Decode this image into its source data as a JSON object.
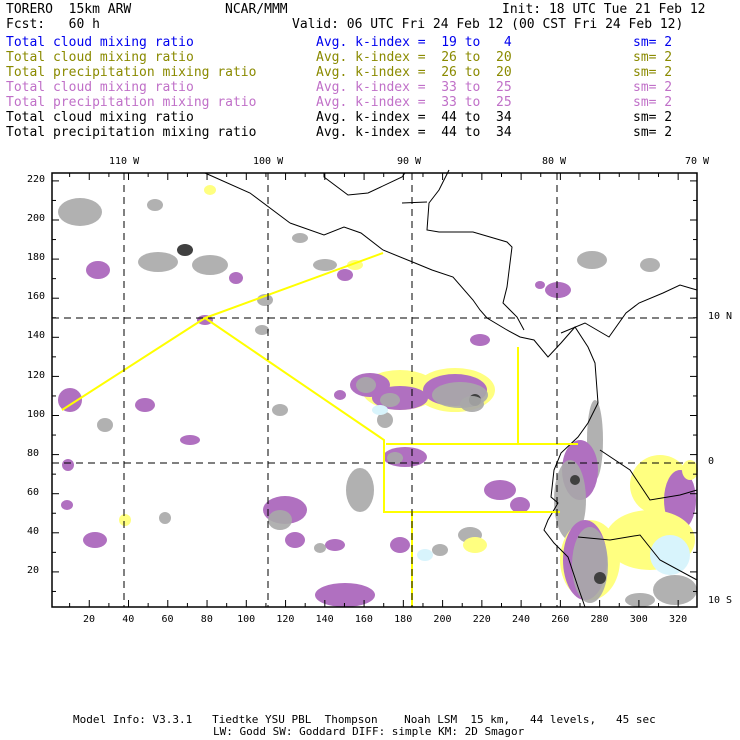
{
  "header": {
    "title": "TORERO  15km ARW",
    "org": "NCAR/MMM",
    "init": "Init: 18 UTC Tue 21 Feb 12",
    "fcst": "Fcst:   60 h",
    "valid": "Valid: 06 UTC Fri 24 Feb 12 (00 CST Fri 24 Feb 12)"
  },
  "legend": [
    {
      "field": "Total cloud mixing ratio",
      "kindex": "Avg. k-index =  19 to   4",
      "sm": "sm= 2",
      "color": "#0000ee"
    },
    {
      "field": "Total cloud mixing ratio",
      "kindex": "Avg. k-index =  26 to  20",
      "sm": "sm= 2",
      "color": "#8a8a00"
    },
    {
      "field": "Total precipitation mixing ratio",
      "kindex": "Avg. k-index =  26 to  20",
      "sm": "sm= 2",
      "color": "#8a8a00"
    },
    {
      "field": "Total cloud mixing ratio",
      "kindex": "Avg. k-index =  33 to  25",
      "sm": "sm= 2",
      "color": "#c070c8"
    },
    {
      "field": "Total precipitation mixing ratio",
      "kindex": "Avg. k-index =  33 to  25",
      "sm": "sm= 2",
      "color": "#c070c8"
    },
    {
      "field": "Total cloud mixing ratio",
      "kindex": "Avg. k-index =  44 to  34",
      "sm": "sm= 2",
      "color": "#000000"
    },
    {
      "field": "Total precipitation mixing ratio",
      "kindex": "Avg. k-index =  44 to  34",
      "sm": "sm= 2",
      "color": "#000000"
    }
  ],
  "map": {
    "lon_labels": [
      "110 W",
      "100 W",
      "90 W",
      "80 W",
      "70 W"
    ],
    "lat_labels": [
      "10 N",
      "0",
      "10 S"
    ],
    "x_ticks": [
      "20",
      "40",
      "60",
      "80",
      "100",
      "120",
      "140",
      "160",
      "180",
      "200",
      "220",
      "240",
      "260",
      "280",
      "300",
      "320"
    ],
    "y_ticks": [
      "220",
      "200",
      "180",
      "160",
      "140",
      "120",
      "100",
      "80",
      "60",
      "40",
      "20"
    ],
    "colors": {
      "light_blue": "#d8f4fc",
      "yellow": "#ffff80",
      "purple": "#b070c0",
      "gray": "#a8a8a8",
      "dark": "#404040",
      "box": "#ffff00"
    }
  },
  "footer": {
    "line1": "Model Info: V3.3.1   Tiedtke YSU PBL  Thompson    Noah LSM  15 km,   44 levels,   45 sec",
    "line2": "LW: Godd SW: Goddard DIFF: simple KM: 2D Smagor"
  }
}
